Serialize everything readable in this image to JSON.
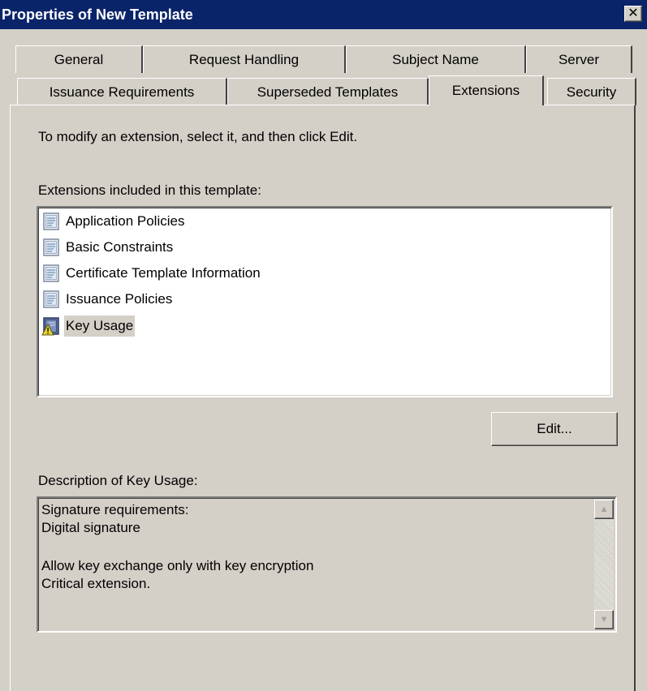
{
  "window": {
    "title": "Properties of New Template",
    "close_symbol": "✕"
  },
  "tabs": {
    "row1": [
      "General",
      "Request Handling",
      "Subject Name",
      "Server"
    ],
    "row2": [
      "Issuance Requirements",
      "Superseded Templates",
      "Extensions",
      "Security"
    ],
    "active": "Extensions"
  },
  "extensions_page": {
    "instruction": "To modify an extension, select it, and then click Edit.",
    "list_label": "Extensions included in this template:",
    "items": [
      {
        "label": "Application Policies",
        "icon": "extension-icon",
        "selected": false
      },
      {
        "label": "Basic Constraints",
        "icon": "extension-icon",
        "selected": false
      },
      {
        "label": "Certificate Template Information",
        "icon": "extension-icon",
        "selected": false
      },
      {
        "label": "Issuance Policies",
        "icon": "extension-icon",
        "selected": false
      },
      {
        "label": "Key Usage",
        "icon": "critical-extension-warning-icon",
        "selected": true
      }
    ],
    "edit_button": "Edit...",
    "description_label": "Description of Key Usage:",
    "description_lines": [
      "Signature requirements:",
      "Digital signature",
      "",
      "Allow key exchange only with key encryption",
      "Critical extension."
    ]
  },
  "colors": {
    "titlebar": "#0a246a",
    "dialog_bg": "#d4d0c8",
    "selection_bg": "#d4d0c8"
  }
}
